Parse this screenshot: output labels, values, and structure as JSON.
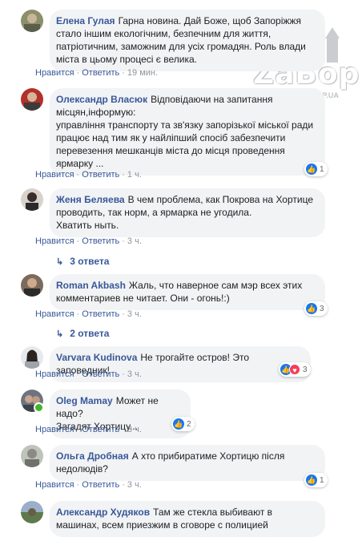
{
  "actions": {
    "like": "Нравится",
    "reply": "Ответить",
    "sep": "·"
  },
  "watermark": {
    "logo": "ZaБор",
    "url": "WWW.ZABOR.ZP.UA"
  },
  "comments": [
    {
      "author": "Елена Гулая",
      "text": "Гарна новина. Дай Боже, щоб Запоріжжя стало іншим екологічним, безпечним для життя, патріотичним, заможним для усіх громадян. Роль влади міста в цьому процесі є велика.",
      "time": "19 мин."
    },
    {
      "author": "Олександр Власюк",
      "text": "Відповідаючи на запитання місцян,інформую:\nуправління транспорту та зв'язку запорізької міської ради працює над тим як у найліпший спосіб забезпечити перевезення мешканців міста до місця проведення ярмарку ...",
      "time": "1 ч.",
      "reactions": "1"
    },
    {
      "author": "Женя Беляева",
      "text": "В чем проблема, как Покрова на Хортице проводить, так норм, а ярмарка не угодила.\nХватить ныть.",
      "time": "3 ч.",
      "replies": "3 ответа"
    },
    {
      "author": "Roman Akbash",
      "text": "Жаль, что наверное сам мэр всех этих комментариев не читает. Они - огонь!:)",
      "time": "3 ч.",
      "reactions": "3",
      "replies": "2 ответа"
    },
    {
      "author": "Varvara Kudinova",
      "text": "Не трогайте остров! Это заповедник!",
      "time": "3 ч.",
      "reactions": "3"
    },
    {
      "author": "Oleg Mamay",
      "text": "Может не надо?\nЗагадят Хортицу...",
      "time": "3 ч.",
      "reactions": "2"
    },
    {
      "author": "Ольга Дробная",
      "text": "А хто прибиратиме Хортицю після недолюдів?",
      "time": "3 ч.",
      "reactions": "1"
    },
    {
      "author": "Александр Худяков",
      "text": "Там же стекла выбивают в машинах, всем приезжим в сговоре с полицией"
    }
  ],
  "colors": {
    "link": "#385898",
    "bubble": "#f2f3f5",
    "like": "#1877f2",
    "love": "#f33e58",
    "online": "#42b72a"
  },
  "icons": {
    "like": "thumbs-up-icon",
    "love": "heart-icon",
    "reply_arrow": "reply-arrow-icon"
  }
}
